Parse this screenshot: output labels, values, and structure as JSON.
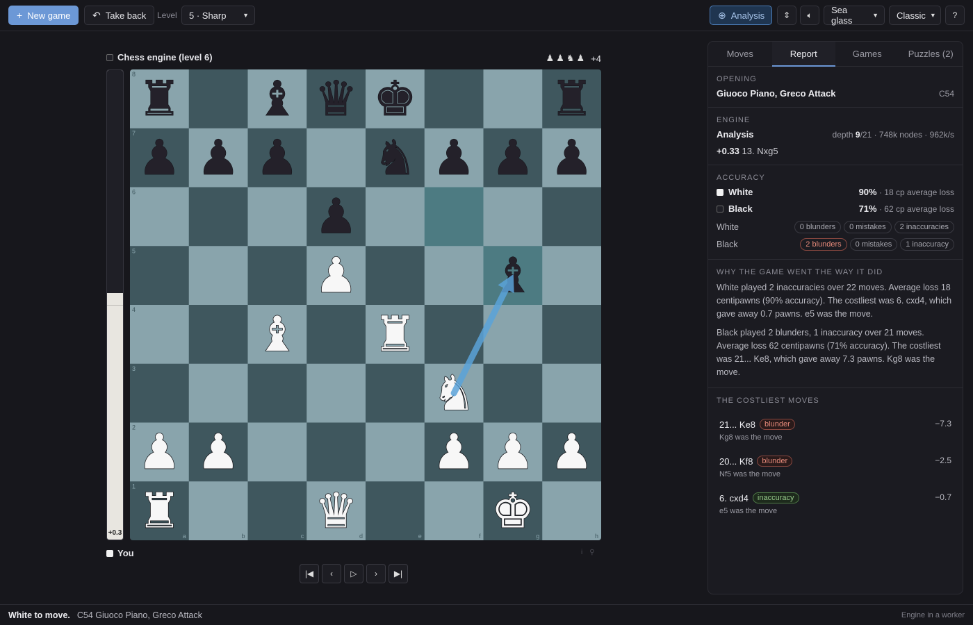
{
  "toolbar": {
    "new_game": "New game",
    "take_back": "Take back",
    "level_label": "Level",
    "level_value": "5 · Sharp",
    "analysis": "Analysis",
    "theme": "Sea glass",
    "piece_set": "Classic"
  },
  "players": {
    "top": "Chess engine (level 6)",
    "bottom": "You",
    "advantage": "+4"
  },
  "eval": {
    "value": "+0.3",
    "white_share": 0.52
  },
  "board": {
    "files": [
      "a",
      "b",
      "c",
      "d",
      "e",
      "f",
      "g",
      "h"
    ],
    "ranks": [
      "8",
      "7",
      "6",
      "5",
      "4",
      "3",
      "2",
      "1"
    ],
    "colors": {
      "light": "#89a4ac",
      "dark": "#3f575e",
      "highlight": "#4d7b82"
    },
    "highlight_squares": [
      "f6",
      "g5"
    ],
    "arrow": {
      "from": "f3",
      "to": "g5",
      "color": "#5ba3d9"
    },
    "pieces": [
      {
        "sq": "a8",
        "p": "bR"
      },
      {
        "sq": "c8",
        "p": "bB"
      },
      {
        "sq": "d8",
        "p": "bQ"
      },
      {
        "sq": "e8",
        "p": "bK"
      },
      {
        "sq": "h8",
        "p": "bR"
      },
      {
        "sq": "a7",
        "p": "bP"
      },
      {
        "sq": "b7",
        "p": "bP"
      },
      {
        "sq": "c7",
        "p": "bP"
      },
      {
        "sq": "e7",
        "p": "bN"
      },
      {
        "sq": "f7",
        "p": "bP"
      },
      {
        "sq": "g7",
        "p": "bP"
      },
      {
        "sq": "h7",
        "p": "bP"
      },
      {
        "sq": "d6",
        "p": "bP"
      },
      {
        "sq": "d5",
        "p": "wP"
      },
      {
        "sq": "g5",
        "p": "bB"
      },
      {
        "sq": "c4",
        "p": "wB"
      },
      {
        "sq": "e4",
        "p": "wR"
      },
      {
        "sq": "f3",
        "p": "wN"
      },
      {
        "sq": "a2",
        "p": "wP"
      },
      {
        "sq": "b2",
        "p": "wP"
      },
      {
        "sq": "f2",
        "p": "wP"
      },
      {
        "sq": "g2",
        "p": "wP"
      },
      {
        "sq": "h2",
        "p": "wP"
      },
      {
        "sq": "a1",
        "p": "wR"
      },
      {
        "sq": "d1",
        "p": "wQ"
      },
      {
        "sq": "g1",
        "p": "wK"
      }
    ]
  },
  "panel": {
    "tabs": [
      "Moves",
      "Report",
      "Games",
      "Puzzles (2)"
    ],
    "opening": {
      "title": "Opening",
      "name": "Giuoco Piano, Greco Attack",
      "eco": "C54"
    },
    "engine": {
      "title": "Engine",
      "label": "Analysis",
      "depth_prefix": "depth",
      "depth": "9",
      "depth_total": "/21 · 748k nodes · 962k/s",
      "eval": "+0.33",
      "best": "13. Nxg5"
    },
    "accuracy": {
      "title": "Accuracy",
      "white_label": "White",
      "white_pct": "90%",
      "white_loss": "· 18 cp average loss",
      "black_label": "Black",
      "black_pct": "71%",
      "black_loss": "· 62 cp average loss",
      "white_row": "White",
      "black_row": "Black",
      "white_pills": [
        "0 blunders",
        "0 mistakes",
        "2 inaccuracies"
      ],
      "black_pills": [
        "2 blunders",
        "0 mistakes",
        "1 inaccuracy"
      ]
    },
    "why": {
      "title": "Why the game went the way it did",
      "white": "White played 2 inaccuracies over 22 moves. Average loss 18 centipawns (90% accuracy). The costliest was 6. cxd4, which gave away 0.7 pawns. e5 was the move.",
      "black": "Black played 2 blunders, 1 inaccuracy over 21 moves. Average loss 62 centipawns (71% accuracy). The costliest was 21... Ke8, which gave away 7.3 pawns. Kg8 was the move."
    },
    "costliest": {
      "title": "The costliest moves",
      "moves": [
        {
          "move": "21... Ke8",
          "tag": "blunder",
          "sub": "Kg8 was the move",
          "loss": "−7.3"
        },
        {
          "move": "20... Kf8",
          "tag": "blunder",
          "sub": "Nf5 was the move",
          "loss": "−2.5"
        },
        {
          "move": "6. cxd4",
          "tag": "inaccuracy",
          "sub": "e5 was the move",
          "loss": "−0.7"
        }
      ]
    }
  },
  "status": {
    "to_move": "White to move.",
    "opening": "C54 Giuoco Piano, Greco Attack",
    "engine": "Engine in a worker"
  }
}
